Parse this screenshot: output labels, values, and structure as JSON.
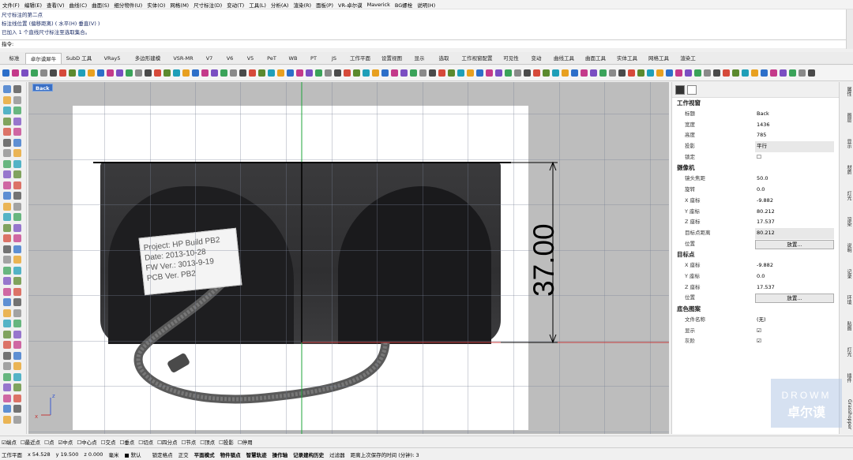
{
  "menu": [
    "文件(F)",
    "编辑(E)",
    "查看(V)",
    "曲线(C)",
    "曲面(S)",
    "细分物件(U)",
    "实体(O)",
    "网格(M)",
    "尺寸标注(D)",
    "变动(T)",
    "工具(L)",
    "分析(A)",
    "渲染(R)",
    "面板(P)",
    "VR-卓尔谟",
    "Maverick",
    "BG螺栓",
    "说明(H)"
  ],
  "command_history": [
    "尺寸标注的第二点",
    "标注线位置 (偏移距离) ( 水平(H)  垂直(V) )",
    "已加入 1 个直线尺寸标注至选取集合。"
  ],
  "command_prompt": "指令:",
  "tabs": [
    "标准",
    "卓尔谟犀牛",
    "SubD 工具",
    "VRay5",
    "多边形建模",
    "VSR-MR",
    "V7",
    "V6",
    "V5",
    "PeT",
    "WB",
    "PT",
    "JS",
    "工作平面",
    "设置视图",
    "显示",
    "选取",
    "工作视窗配置",
    "可见性",
    "变动",
    "曲线工具",
    "曲面工具",
    "实体工具",
    "网格工具",
    "渲染工"
  ],
  "viewport": {
    "title": "Back",
    "dimension_value": "37.00",
    "label_lines": [
      "Project: HP Build  PB2",
      "Date: 2013-10-28",
      "FW Ver.: 3013-9-19",
      "PCB Ver.  PB2"
    ],
    "axis_x": "x",
    "axis_z": "z"
  },
  "properties": {
    "section_viewport": "工作视窗",
    "rows_viewport": [
      {
        "k": "标题",
        "v": "Back"
      },
      {
        "k": "宽度",
        "v": "1436"
      },
      {
        "k": "高度",
        "v": "785"
      },
      {
        "k": "投影",
        "v": "平行"
      },
      {
        "k": "锁定",
        "v": "☐"
      }
    ],
    "section_camera": "摄像机",
    "rows_camera": [
      {
        "k": "镜头焦距",
        "v": "50.0"
      },
      {
        "k": "旋转",
        "v": "0.0"
      },
      {
        "k": "X 座标",
        "v": "-9.882"
      },
      {
        "k": "Y 座标",
        "v": "80.212"
      },
      {
        "k": "Z 座标",
        "v": "17.537"
      },
      {
        "k": "目标点距离",
        "v": "80.212"
      }
    ],
    "position_label": "位置",
    "place_button": "放置...",
    "section_target": "目标点",
    "rows_target": [
      {
        "k": "X 座标",
        "v": "-9.882"
      },
      {
        "k": "Y 座标",
        "v": "0.0"
      },
      {
        "k": "Z 座标",
        "v": "17.537"
      }
    ],
    "section_background": "底色图案",
    "rows_background": [
      {
        "k": "文件名称",
        "v": "(无)"
      },
      {
        "k": "显示",
        "v": "☑"
      },
      {
        "k": "灰阶",
        "v": "☑"
      }
    ],
    "browse_button": "..."
  },
  "side_tabs": [
    "属性",
    "图层",
    "显示",
    "材质",
    "灯光",
    "渲染",
    "说明",
    "记录",
    "环境",
    "贴图",
    "灯光",
    "插件",
    "Grasshopper"
  ],
  "osnap": [
    "☑端点",
    "☐最近点",
    "☐点",
    "☑中点",
    "☐中心点",
    "☐交点",
    "☐垂点",
    "☐切点",
    "☐四分点",
    "☐节点",
    "☐顶点",
    "☐投影",
    "☐停用"
  ],
  "status": {
    "cplane": "工作平面",
    "x": "x 54.528",
    "y": "y 19.500",
    "z": "z 0.000",
    "unit": "毫米",
    "layer": "默认",
    "items": [
      "锁定格点",
      "正交",
      "平面模式",
      "物件锁点",
      "智慧轨迹",
      "操作轴",
      "记录建构历史",
      "过滤器",
      "距离上次保存的时间 (分钟): 3"
    ]
  },
  "watermark": {
    "line1": "DROWM",
    "line2": "卓尔谟"
  },
  "colors": {
    "viewport_label": "#3a6fc4",
    "viewport_bg": "#bdbdbd",
    "green_axis": "#1fa53a",
    "red_axis": "#c43a3a"
  }
}
